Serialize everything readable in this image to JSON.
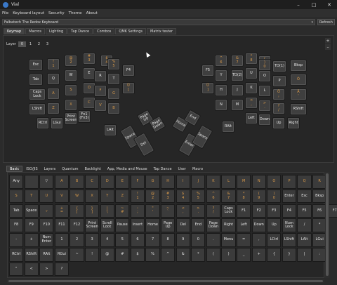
{
  "window": {
    "title": "Vial",
    "min": "–",
    "max": "□",
    "close": "✕"
  },
  "menu": [
    "File",
    "Keyboard layout",
    "Security",
    "Theme",
    "About"
  ],
  "keyboard_select": {
    "value": "Falbatech The Redox Keyboard",
    "refresh": "Refresh"
  },
  "top_tabs": [
    "Keymap",
    "Macros",
    "Lighting",
    "Tap Dance",
    "Combos",
    "QMK Settings",
    "Matrix tester"
  ],
  "layer": {
    "label": "Layer",
    "buttons": [
      "0",
      "1",
      "2",
      "3"
    ],
    "selected": 0
  },
  "side_buttons": [
    "+",
    "–"
  ],
  "colors": {
    "accent_orange": "#d99a4a",
    "bg": "#2b2b2b",
    "key": "#3f3f3f"
  },
  "keymap_keys": [
    "Esc",
    "!\n1",
    "@\n2",
    "#\n3",
    "$\n4",
    "%\n5",
    "F4",
    "Tab",
    "Q",
    "W",
    "E",
    "R",
    "T",
    "Caps\nLock",
    "A",
    "S",
    "D",
    "F",
    "G",
    "Ü\n[",
    "LShift",
    "Z",
    "X",
    "C",
    "V",
    "B",
    "Print\nScreen",
    "RCtrl",
    "LGui",
    "Fn1\n(Fn3)",
    "LAlt",
    "Page\nUp",
    "Page\nDown",
    "Space",
    "Del",
    "F5",
    "^\n6",
    "&\n7",
    "*\n8",
    "(\n9",
    ")\n0",
    "TD(1)",
    "Bksp",
    "Y",
    "TD(2)",
    "U",
    "I",
    "O",
    "P",
    "Õ",
    "H",
    "J",
    "K",
    "L",
    "Ö\n;",
    "Ä\n'",
    "Ü\n]",
    "N",
    "M",
    "<\n,",
    ">\n.",
    "?\n/",
    "RShift",
    "Left",
    "Down",
    "Up",
    "Right",
    "RAlt",
    "Home",
    "End",
    "Enter",
    "Space"
  ],
  "bottom_tabs": [
    "Basic",
    "ISO/JIS",
    "Layers",
    "Quantum",
    "Backlight",
    "App, Media and Mouse",
    "Tap Dance",
    "User",
    "Macro"
  ],
  "palette": [
    [
      "Any",
      "",
      "▽",
      "A",
      "B",
      "C",
      "D",
      "E",
      "F",
      "G",
      "H",
      "I",
      "J",
      "K",
      "L",
      "M",
      "N",
      "O",
      "P",
      "Q",
      "R"
    ],
    [
      "S",
      "T",
      "U",
      "V",
      "W",
      "X",
      "Y",
      "Z",
      "!\n1",
      "@\n2",
      "#\n3",
      "$\n4",
      "%\n5",
      "^\n6",
      "&\n7",
      "*\n8",
      "(\n9",
      ")\n0",
      "Enter",
      "Esc",
      "Bksp"
    ],
    [
      "Tab",
      "Space",
      "_\n-",
      "+\n=",
      "{\n[",
      "}\n]",
      "|\n\\",
      "~\n#",
      ":\n;",
      "\"\n'",
      "~\n`",
      "<\n,",
      ">\n.",
      "?\n/",
      "Caps\nLock",
      "F1",
      "F2",
      "F3",
      "F4",
      "F5",
      "F6",
      "F7"
    ],
    [
      "F8",
      "F9",
      "F10",
      "F11",
      "F12",
      "Print\nScreen",
      "Scroll\nLock",
      "Pause",
      "Insert",
      "Home",
      "Page\nUp",
      "Del",
      "End",
      "Page\nDown",
      "Right",
      "Left",
      "Down",
      "Up",
      "Num\nLock",
      "/",
      "*"
    ],
    [
      "-",
      "+",
      "Num\nEnter",
      "1",
      "2",
      "3",
      "4",
      "5",
      "6",
      "7",
      "8",
      "9",
      "0",
      ".",
      "Menu",
      "=",
      ",",
      "LCtrl",
      "LShift",
      "LAlt",
      "LGui"
    ],
    [
      "RCtrl",
      "RShift",
      "RAlt",
      "RGui",
      "~",
      "!",
      "@",
      "#",
      "$",
      "%",
      "^",
      "&",
      "*",
      "(",
      ")",
      "_",
      "+",
      "{",
      "}",
      "|",
      ":"
    ],
    [
      "\"",
      "<",
      ">",
      "?"
    ]
  ]
}
